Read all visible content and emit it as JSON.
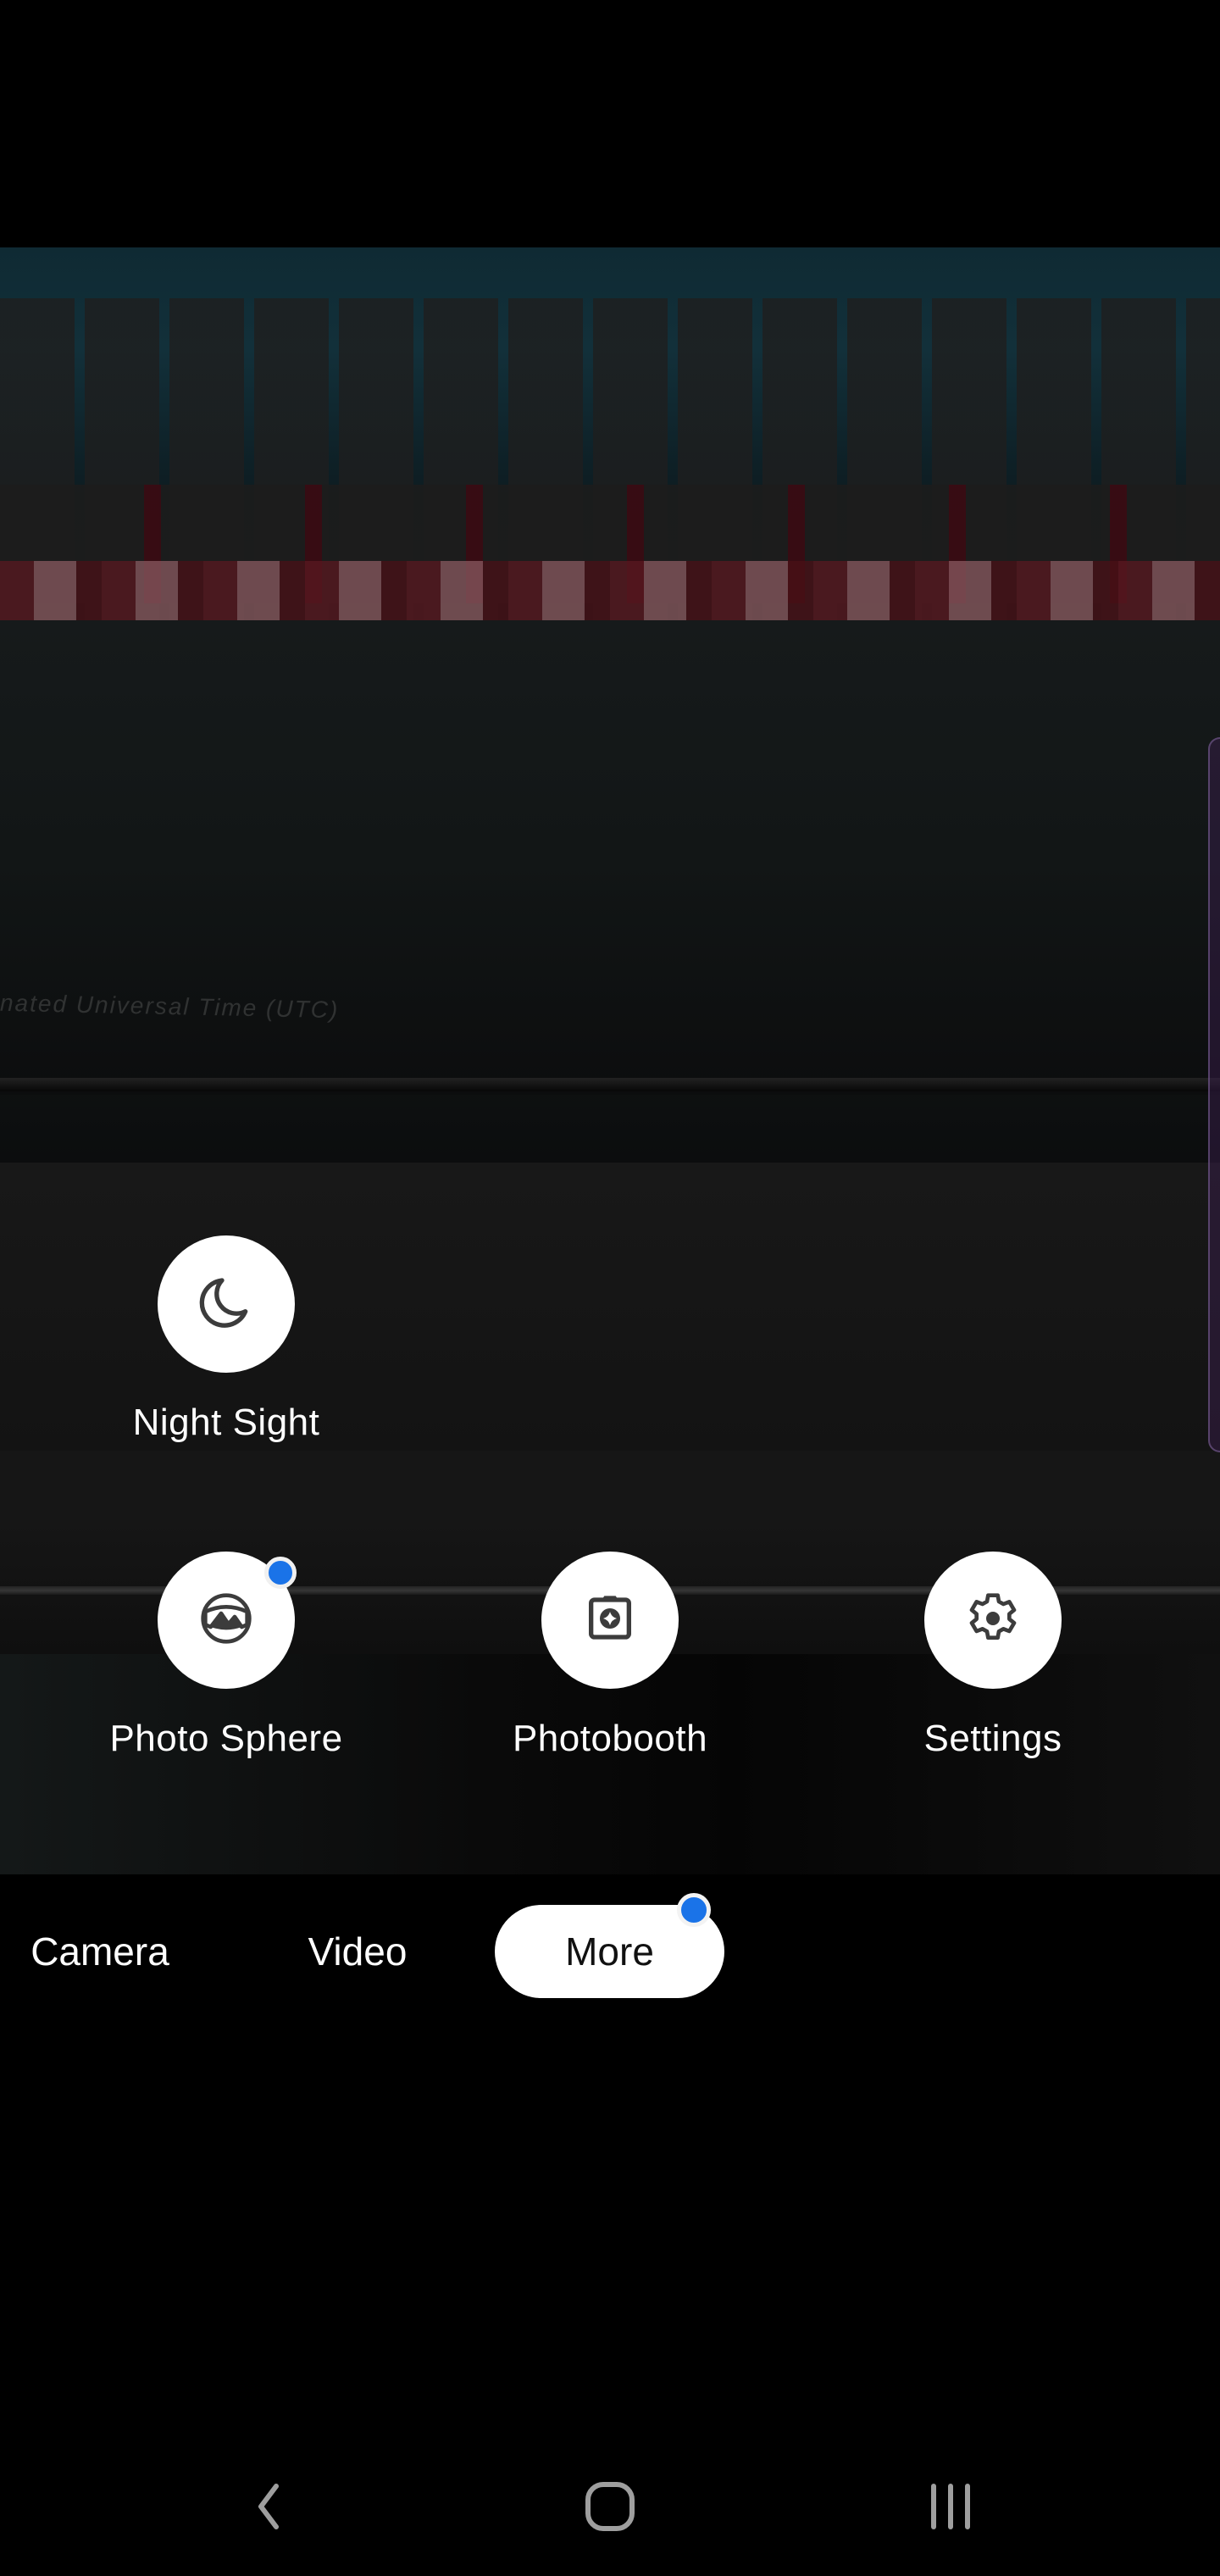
{
  "app": {
    "name": "Camera"
  },
  "viewfinder": {
    "imprint_text": "nated Universal Time (UTC)"
  },
  "more_modes": [
    {
      "label": "Night Sight",
      "icon": "moon-icon",
      "badge": false
    },
    {
      "label": "Photo Sphere",
      "icon": "photo-sphere-icon",
      "badge": true
    },
    {
      "label": "Photobooth",
      "icon": "photobooth-camera-icon",
      "badge": false
    },
    {
      "label": "Settings",
      "icon": "gear-icon",
      "badge": false
    }
  ],
  "mode_tabs": [
    {
      "label": "Camera",
      "active": false
    },
    {
      "label": "Video",
      "active": false
    },
    {
      "label": "More",
      "active": true,
      "badge": true
    }
  ],
  "nav_bar": {
    "back": "back-icon",
    "home": "home-icon",
    "recents": "recents-icon"
  },
  "colors": {
    "badge": "#1a73e8",
    "active_tab_bg": "#ffffff",
    "icon": "#3c3c3c",
    "nav_icon": "#9e9e9e"
  }
}
